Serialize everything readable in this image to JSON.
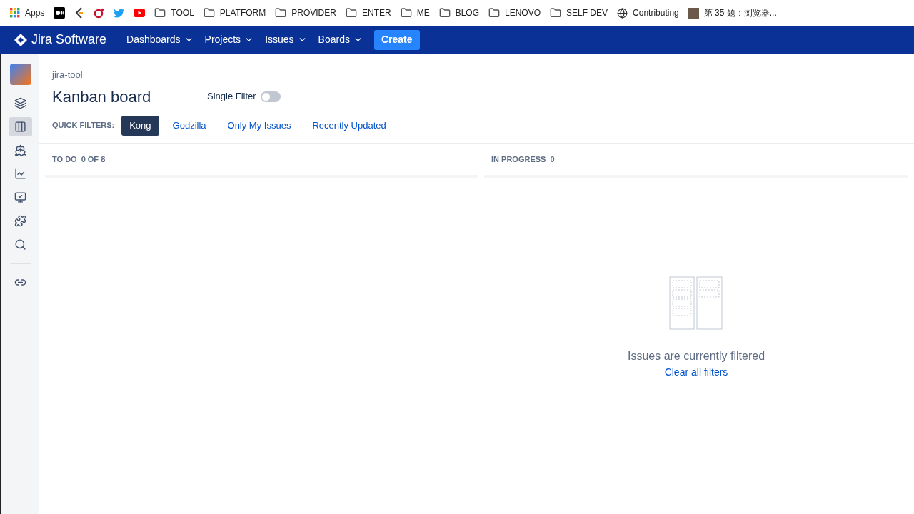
{
  "bookmarks": [
    {
      "kind": "apps",
      "label": "Apps"
    },
    {
      "kind": "medium"
    },
    {
      "kind": "chevron"
    },
    {
      "kind": "ring"
    },
    {
      "kind": "bird"
    },
    {
      "kind": "play"
    },
    {
      "kind": "folder",
      "label": "TOOL"
    },
    {
      "kind": "folder",
      "label": "PLATFORM"
    },
    {
      "kind": "folder",
      "label": "PROVIDER"
    },
    {
      "kind": "folder",
      "label": "ENTER"
    },
    {
      "kind": "folder",
      "label": "ME"
    },
    {
      "kind": "folder",
      "label": "BLOG"
    },
    {
      "kind": "folder",
      "label": "LENOVO"
    },
    {
      "kind": "folder",
      "label": "SELF DEV"
    },
    {
      "kind": "globe",
      "label": "Contributing"
    },
    {
      "kind": "photo",
      "label": "第 35 题：浏览器..."
    }
  ],
  "nav": {
    "brand": "Jira Software",
    "menus": [
      "Dashboards",
      "Projects",
      "Issues",
      "Boards"
    ],
    "create": "Create"
  },
  "sidebar": {
    "items": [
      {
        "kind": "backlog",
        "selected": false
      },
      {
        "kind": "board",
        "selected": true
      },
      {
        "kind": "releases",
        "selected": false
      },
      {
        "kind": "reports",
        "selected": false
      },
      {
        "kind": "monitor",
        "selected": false
      },
      {
        "kind": "addons",
        "selected": false
      },
      {
        "kind": "search",
        "selected": false
      }
    ],
    "footer_items": [
      {
        "kind": "link",
        "selected": false
      }
    ]
  },
  "breadcrumb": "jira-tool",
  "title": "Kanban board",
  "single_filter": {
    "label": "Single Filter",
    "on": false
  },
  "quick_filters": {
    "label": "QUICK FILTERS:",
    "items": [
      {
        "label": "Kong",
        "selected": true
      },
      {
        "label": "Godzilla",
        "selected": false
      },
      {
        "label": "Only My Issues",
        "selected": false
      },
      {
        "label": "Recently Updated",
        "selected": false
      }
    ]
  },
  "columns": [
    {
      "name": "TO DO",
      "count": "0 OF 8"
    },
    {
      "name": "IN PROGRESS",
      "count": "0",
      "empty": {
        "message": "Issues are currently filtered",
        "link": "Clear all filters"
      }
    }
  ]
}
